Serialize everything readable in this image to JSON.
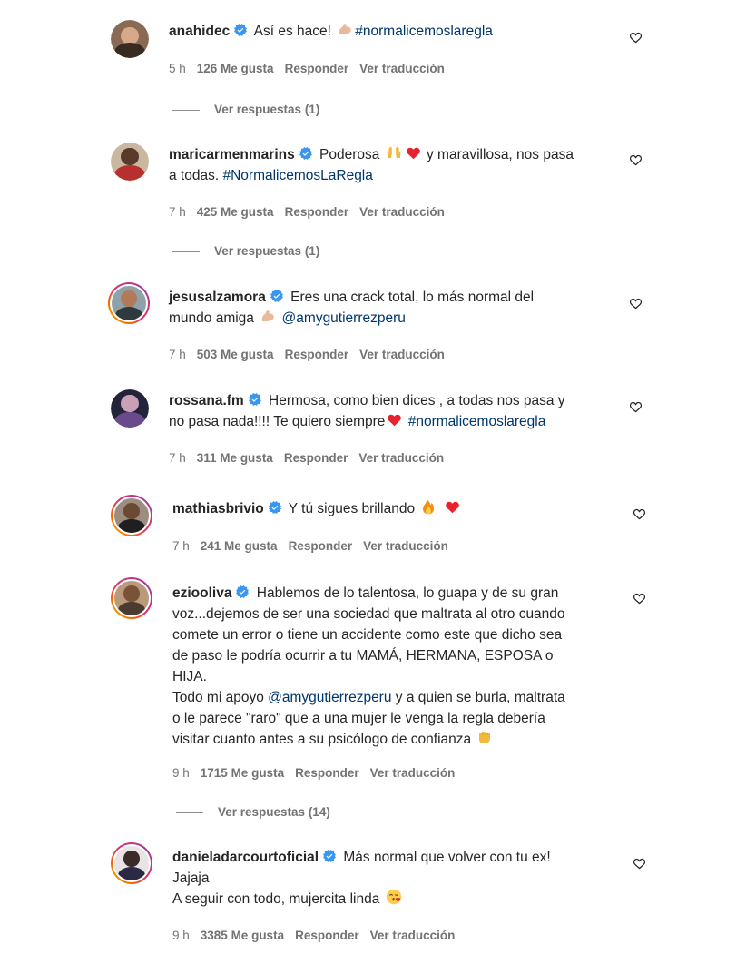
{
  "colors": {
    "text": "#262626",
    "meta": "#737373",
    "link": "#00376b",
    "verified": "#3897f0",
    "heart": "#e8222d"
  },
  "comments": [
    {
      "username": "anahidec",
      "parts": [
        " Así es hace! ",
        "#normalicemoslaregla"
      ],
      "time": "5 h",
      "likes": "126 Me gusta",
      "reply": "Responder",
      "translate": "Ver traducción",
      "view_replies": "Ver respuestas (1)"
    },
    {
      "username": "maricarmenmarins",
      "line1": " Poderosa ",
      "line1b": " y maravillosa, nos pasa",
      "line2a": "a todas. ",
      "hashtag": "#NormalicemosLaRegla",
      "time": "7 h",
      "likes": "425 Me gusta",
      "reply": "Responder",
      "translate": "Ver traducción",
      "view_replies": "Ver respuestas (1)"
    },
    {
      "username": "jesusalzamora",
      "line1": " Eres una crack total, lo más normal del",
      "line2a": "mundo amiga ",
      "mention": "@amygutierrezperu",
      "time": "7 h",
      "likes": "503 Me gusta",
      "reply": "Responder",
      "translate": "Ver traducción"
    },
    {
      "username": "rossana.fm",
      "line1": " Hermosa, como bien dices , a todas nos pasa y",
      "line2a": "no pasa nada!!!! Te quiero siempre",
      "hashtag": "#normalicemoslaregla",
      "time": "7 h",
      "likes": "311 Me gusta",
      "reply": "Responder",
      "translate": "Ver traducción"
    },
    {
      "username": "mathiasbrivio",
      "line1": " Y tú sigues brillando ",
      "time": "7 h",
      "likes": "241 Me gusta",
      "reply": "Responder",
      "translate": "Ver traducción"
    },
    {
      "username": "eziooliva",
      "line1": " Hablemos de lo talentosa, lo guapa y de su gran",
      "lines": [
        "voz...dejemos de ser una sociedad que maltrata al otro cuando",
        "comete un error o tiene un accidente como este que dicho sea",
        "de paso le podría ocurrir a tu MAMÁ, HERMANA, ESPOSA o",
        "HIJA."
      ],
      "line6a": "Todo mi apoyo ",
      "mention": "@amygutierrezperu",
      "line6b": " y a quien se burla, maltrata",
      "line7": "o le parece \"raro\" que a una mujer le venga la regla debería",
      "line8": "visitar cuanto antes a su psicólogo de confianza ",
      "time": "9 h",
      "likes": "1715 Me gusta",
      "reply": "Responder",
      "translate": "Ver traducción",
      "view_replies": "Ver respuestas (14)"
    },
    {
      "username": "danieladarcourtoficial",
      "line1": " Más normal que volver con tu ex!",
      "line2": "Jajaja",
      "line3": "A seguir con todo, mujercita linda ",
      "time": "9 h",
      "likes": "3385 Me gusta",
      "reply": "Responder",
      "translate": "Ver traducción"
    }
  ]
}
